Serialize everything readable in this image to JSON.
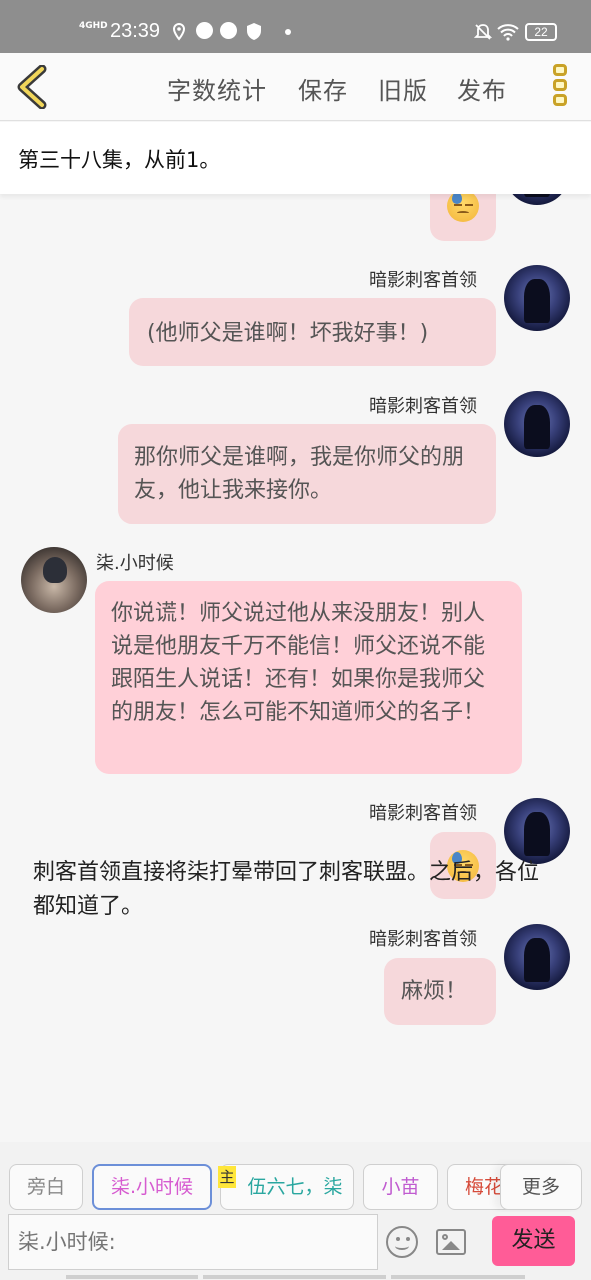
{
  "status_bar": {
    "network": "4GHD",
    "time": "23:39",
    "battery": "22"
  },
  "toolbar": {
    "items": [
      "字数统计",
      "保存",
      "旧版",
      "发布"
    ]
  },
  "episode_title": "第三十八集，从前1。",
  "messages": [
    {
      "speaker": "暗影刺客首领",
      "side": "right",
      "text": "(他师父是谁啊！坏我好事！)"
    },
    {
      "speaker": "暗影刺客首领",
      "side": "right",
      "text": "那你师父是谁啊，我是你师父的朋友，他让我来接你。"
    },
    {
      "speaker": "柒.小时候",
      "side": "left",
      "text": "你说谎！师父说过他从来没朋友！别人说是他朋友千万不能信！师父还说不能跟陌生人说话！还有！如果你是我师父的朋友！怎么可能不知道师父的名子！"
    },
    {
      "speaker": "暗影刺客首领",
      "side": "right",
      "emoji": "downcast-sweat-face"
    },
    {
      "speaker": "暗影刺客首领",
      "side": "right",
      "text": "麻烦！"
    }
  ],
  "narration": "刺客首领直接将柒打晕带回了刺客联盟。之后，各位都知道了。",
  "roles": {
    "chips": [
      {
        "label": "旁白",
        "color": "#888888"
      },
      {
        "label": "柒.小时候",
        "color": "#d65bd0"
      },
      {
        "label": "伍六七，柒",
        "color": "#2aa7a0"
      },
      {
        "label": "小苗",
        "color": "#c05bd0"
      },
      {
        "label": "梅花",
        "color": "#d64b3a"
      }
    ],
    "main_tag": "主",
    "more_label": "更多"
  },
  "input": {
    "placeholder": "柒.小时候:",
    "send_label": "发送"
  },
  "colors": {
    "accent": "#ff5c97",
    "bubble_right": "#f6d8db",
    "bubble_left": "#ffd0d8"
  }
}
